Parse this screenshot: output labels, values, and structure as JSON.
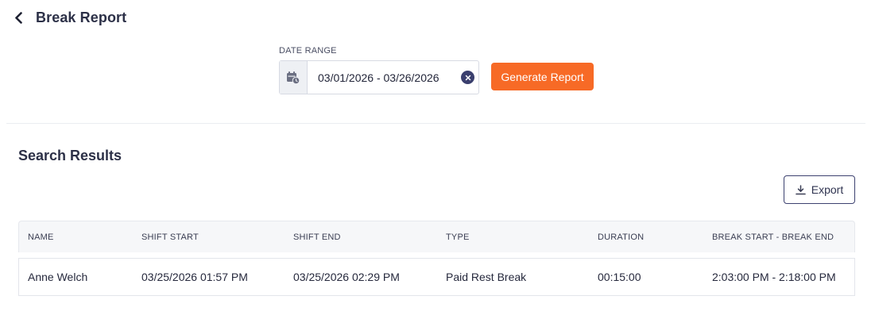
{
  "header": {
    "title": "Break Report",
    "back_icon": "chevron-left-icon"
  },
  "filter": {
    "label": "DATE RANGE",
    "date_range_value": "03/01/2026 - 03/26/2026",
    "calendar_icon": "calendar-clock-icon",
    "clear_icon": "close-icon",
    "generate_label": "Generate Report"
  },
  "results": {
    "title": "Search Results",
    "export_label": "Export",
    "columns": [
      "NAME",
      "SHIFT START",
      "SHIFT END",
      "TYPE",
      "DURATION",
      "BREAK START - BREAK END"
    ],
    "rows": [
      {
        "name": "Anne Welch",
        "shift_start": "03/25/2026 01:57 PM",
        "shift_end": "03/25/2026 02:29 PM",
        "type": "Paid Rest Break",
        "duration": "00:15:00",
        "break_range": "2:03:00 PM - 2:18:00 PM"
      }
    ]
  },
  "colors": {
    "accent": "#f76a26",
    "primary_dark": "#3a3f6e",
    "text": "#2c3047"
  }
}
